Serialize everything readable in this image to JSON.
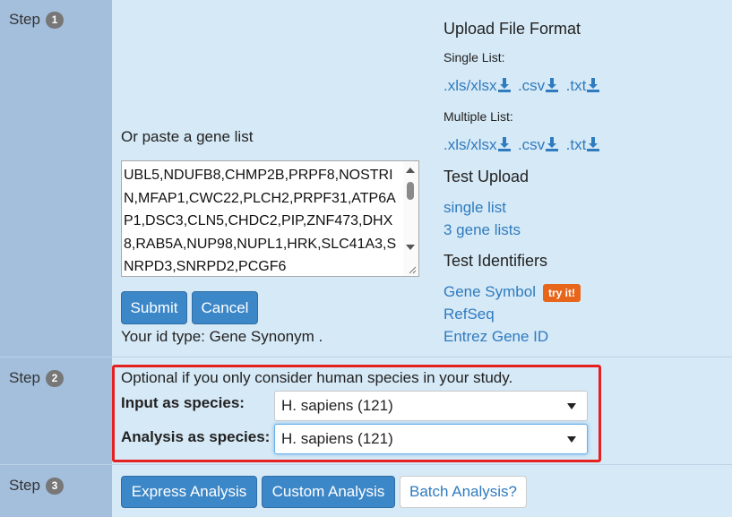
{
  "steps": [
    {
      "label": "Step",
      "number": "1"
    },
    {
      "label": "Step",
      "number": "2"
    },
    {
      "label": "Step",
      "number": "3"
    }
  ],
  "step1": {
    "paste_label": "Or paste a gene list",
    "gene_list": "UBL5,NDUFB8,CHMP2B,PRPF8,NOSTRIN,MFAP1,CWC22,PLCH2,PRPF31,ATP6AP1,DSC3,CLN5,CHDC2,PIP,ZNF473,DHX8,RAB5A,NUP98,NUPL1,HRK,SLC41A3,SNRPD3,SNRPD2,PCGF6",
    "submit_label": "Submit",
    "cancel_label": "Cancel",
    "id_type_text": "Your id type: Gene Synonym ."
  },
  "upload_format": {
    "title": "Upload File Format",
    "single_list_label": "Single List:",
    "multiple_list_label": "Multiple List:",
    "formats": [
      ".xls/xlsx",
      ".csv",
      ".txt"
    ]
  },
  "test_upload": {
    "title": "Test Upload",
    "links": [
      "single list",
      "3 gene lists"
    ]
  },
  "test_identifiers": {
    "title": "Test Identifiers",
    "links": [
      "Gene Symbol",
      "RefSeq",
      "Entrez Gene ID"
    ],
    "try_badge": "try it!"
  },
  "step2": {
    "optional_text": "Optional if you only consider human species in your study.",
    "input_species_label": "Input as species:",
    "input_species_value": "H. sapiens (121)",
    "analysis_species_label": "Analysis as species:",
    "analysis_species_value": "H. sapiens (121)"
  },
  "step3": {
    "express_label": "Express Analysis",
    "custom_label": "Custom Analysis",
    "batch_label": "Batch Analysis?"
  },
  "colors": {
    "step_column": "#a4bfdc",
    "content_bg": "#d6e9f6",
    "primary_button": "#3c87c8",
    "link": "#2f7bbf",
    "highlight_box": "#e52020",
    "try_badge": "#e8661c"
  }
}
